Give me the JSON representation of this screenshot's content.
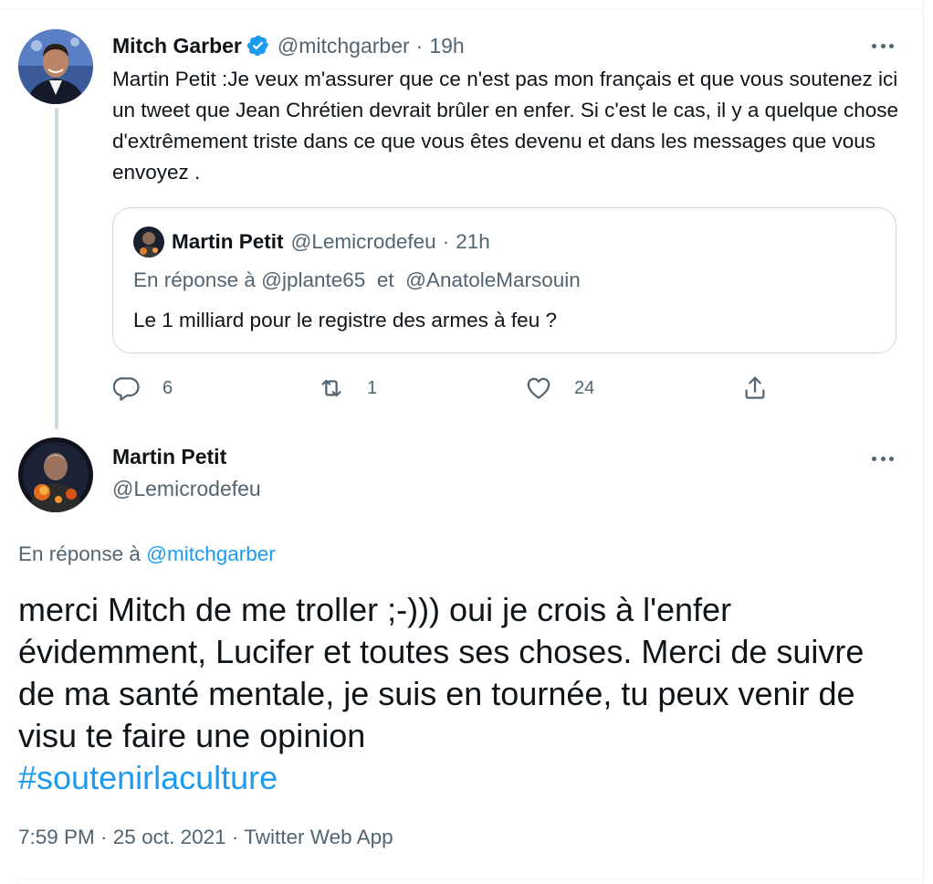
{
  "colors": {
    "text": "#0f1419",
    "secondary": "#536471",
    "link": "#1d9bf0",
    "border": "#cfd9de",
    "verified": "#1d9bf0"
  },
  "parent_tweet": {
    "author_name": "Mitch Garber",
    "verified": true,
    "handle": "@mitchgarber",
    "separator": "·",
    "time": "19h",
    "text": "Martin Petit :Je veux m'assurer que ce n'est pas mon français et que vous soutenez ici un tweet que Jean Chrétien devrait brûler en enfer. Si c'est le cas, il y a quelque chose d'extrêmement triste dans ce que vous êtes devenu et dans les messages que vous envoyez .",
    "quoted_tweet": {
      "author_name": "Martin Petit",
      "handle": "@Lemicrodefeu",
      "separator": "·",
      "time": "21h",
      "reply_prefix": "En réponse à",
      "reply_user_1": "@jplante65",
      "reply_joiner": "et",
      "reply_user_2": "@AnatoleMarsouin",
      "text": "Le 1 milliard pour le registre des armes à feu ?"
    },
    "actions": {
      "reply_icon": "reply-icon",
      "reply_count": "6",
      "retweet_icon": "retweet-icon",
      "retweet_count": "1",
      "like_icon": "heart-icon",
      "like_count": "24",
      "share_icon": "share-icon"
    }
  },
  "main_tweet": {
    "author_name": "Martin Petit",
    "handle": "@Lemicrodefeu",
    "reply_prefix": "En réponse à",
    "reply_user": "@mitchgarber",
    "text": "merci Mitch de me troller ;-))) oui je crois à l'enfer évidemment, Lucifer et toutes ses choses. Merci de suivre de ma santé mentale, je suis en tournée, tu peux venir de visu te faire une opinion",
    "hashtag": "#soutenirlaculture",
    "timestamp": "7:59 PM · 25 oct. 2021 · ",
    "source": "Twitter Web App"
  }
}
